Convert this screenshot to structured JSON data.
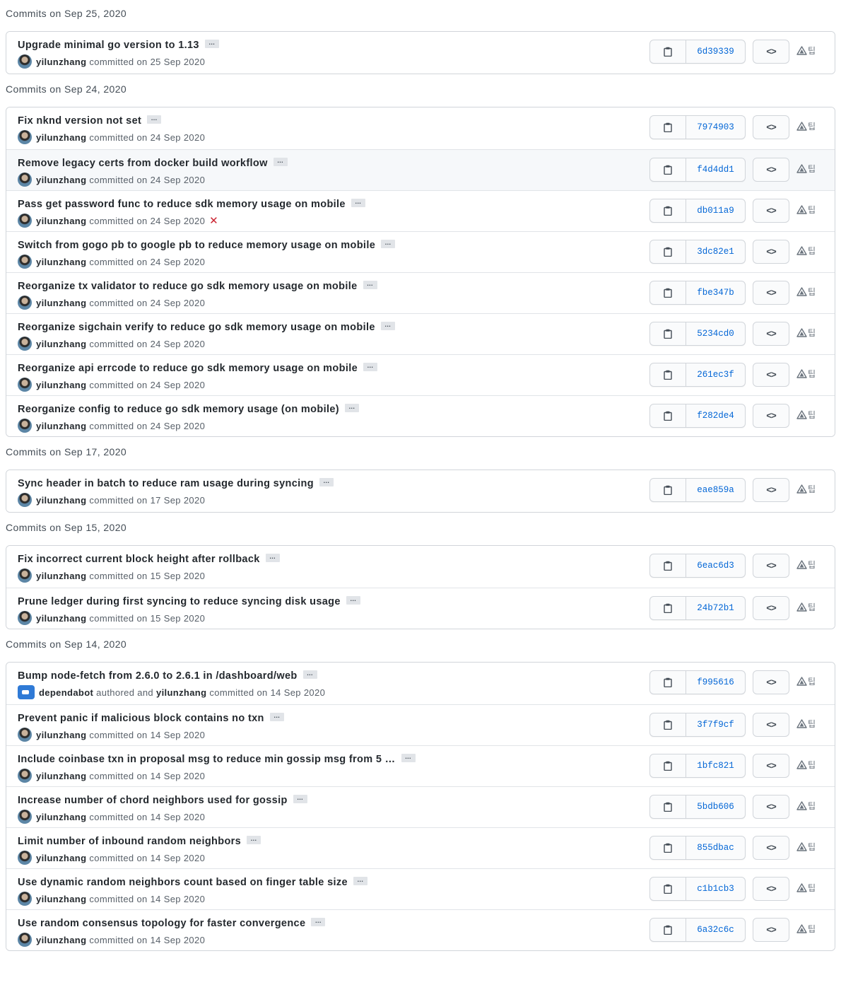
{
  "groups": [
    {
      "heading": "Commits on Sep 25, 2020",
      "commits": [
        {
          "message": "Upgrade minimal go version to 1.13",
          "author": "yilunzhang",
          "meta": "committed on 25 Sep 2020",
          "sha": "6d39339"
        }
      ]
    },
    {
      "heading": "Commits on Sep 24, 2020",
      "commits": [
        {
          "message": "Fix nknd version not set",
          "author": "yilunzhang",
          "meta": "committed on 24 Sep 2020",
          "sha": "7974903"
        },
        {
          "message": "Remove legacy certs from docker build workflow",
          "author": "yilunzhang",
          "meta": "committed on 24 Sep 2020",
          "sha": "f4d4dd1",
          "highlight": true
        },
        {
          "message": "Pass get password func to reduce sdk memory usage on mobile",
          "author": "yilunzhang",
          "meta": "committed on 24 Sep 2020",
          "sha": "db011a9",
          "status": "✕"
        },
        {
          "message": "Switch from gogo pb to google pb to reduce memory usage on mobile",
          "author": "yilunzhang",
          "meta": "committed on 24 Sep 2020",
          "sha": "3dc82e1"
        },
        {
          "message": "Reorganize tx validator to reduce go sdk memory usage on mobile",
          "author": "yilunzhang",
          "meta": "committed on 24 Sep 2020",
          "sha": "fbe347b"
        },
        {
          "message": "Reorganize sigchain verify to reduce go sdk memory usage on mobile",
          "author": "yilunzhang",
          "meta": "committed on 24 Sep 2020",
          "sha": "5234cd0"
        },
        {
          "message": "Reorganize api errcode to reduce go sdk memory usage on mobile",
          "author": "yilunzhang",
          "meta": "committed on 24 Sep 2020",
          "sha": "261ec3f"
        },
        {
          "message": "Reorganize config to reduce go sdk memory usage (on mobile)",
          "author": "yilunzhang",
          "meta": "committed on 24 Sep 2020",
          "sha": "f282de4"
        }
      ]
    },
    {
      "heading": "Commits on Sep 17, 2020",
      "commits": [
        {
          "message": "Sync header in batch to reduce ram usage during syncing",
          "author": "yilunzhang",
          "meta": "committed on 17 Sep 2020",
          "sha": "eae859a"
        }
      ]
    },
    {
      "heading": "Commits on Sep 15, 2020",
      "commits": [
        {
          "message": "Fix incorrect current block height after rollback",
          "author": "yilunzhang",
          "meta": "committed on 15 Sep 2020",
          "sha": "6eac6d3"
        },
        {
          "message": "Prune ledger during first syncing to reduce syncing disk usage",
          "author": "yilunzhang",
          "meta": "committed on 15 Sep 2020",
          "sha": "24b72b1"
        }
      ]
    },
    {
      "heading": "Commits on Sep 14, 2020",
      "commits": [
        {
          "message": "Bump node-fetch from 2.6.0 to 2.6.1 in /dashboard/web",
          "author": "dependabot",
          "bot": true,
          "mid": "authored and",
          "author2": "yilunzhang",
          "meta": "committed on 14 Sep 2020",
          "sha": "f995616"
        },
        {
          "message": "Prevent panic if malicious block contains no txn",
          "author": "yilunzhang",
          "meta": "committed on 14 Sep 2020",
          "sha": "3f7f9cf"
        },
        {
          "message": "Include coinbase txn in proposal msg to reduce min gossip msg from 5 …",
          "author": "yilunzhang",
          "meta": "committed on 14 Sep 2020",
          "sha": "1bfc821"
        },
        {
          "message": "Increase number of chord neighbors used for gossip",
          "author": "yilunzhang",
          "meta": "committed on 14 Sep 2020",
          "sha": "5bdb606"
        },
        {
          "message": "Limit number of inbound random neighbors",
          "author": "yilunzhang",
          "meta": "committed on 14 Sep 2020",
          "sha": "855dbac"
        },
        {
          "message": "Use dynamic random neighbors count based on finger table size",
          "author": "yilunzhang",
          "meta": "committed on 14 Sep 2020",
          "sha": "c1b1cb3"
        },
        {
          "message": "Use random consensus topology for faster convergence",
          "author": "yilunzhang",
          "meta": "committed on 14 Sep 2020",
          "sha": "6a32c6c"
        }
      ]
    }
  ],
  "labels": {
    "ellipsis": "…",
    "browse": "<>",
    "ext_glyph": "팁"
  },
  "icons": {
    "copy": "clipboard-icon",
    "browse": "code-icon",
    "ext": "warning-triangle-icon"
  },
  "colors": {
    "sha_link": "#0366d6",
    "fail": "#cb2431",
    "border": "#d1d5da"
  }
}
